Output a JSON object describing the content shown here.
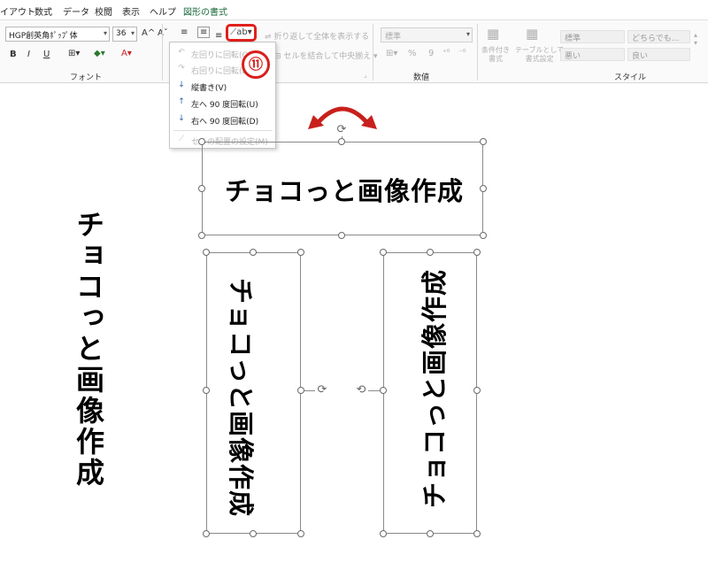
{
  "tabs": [
    {
      "label": "イアウト",
      "active": false
    },
    {
      "label": "数式",
      "active": false
    },
    {
      "label": "データ",
      "active": false
    },
    {
      "label": "校閲",
      "active": false
    },
    {
      "label": "表示",
      "active": false
    },
    {
      "label": "ヘルプ",
      "active": false
    },
    {
      "label": "図形の書式",
      "active": true
    }
  ],
  "ribbon": {
    "font_name": "HGP創英角ﾎﾟｯﾌﾟ体",
    "font_size": "36",
    "grow_font": "A^",
    "shrink_font": "Aˇ",
    "bold": "B",
    "italic": "I",
    "underline": "U",
    "font_group_label": "フォント",
    "wrap_text": "折り返して全体を表示する",
    "merge_center": "セルを結合して中央揃え",
    "number_format": "標準",
    "percent": "%",
    "comma": "9",
    "number_group_label": "数値",
    "conditional_format": "条件付き\n書式",
    "format_as_table": "テーブルとして\n書式設定",
    "styles": [
      "標準",
      "どちらでも...",
      "悪い",
      "良い"
    ],
    "style_group_label": "スタイル"
  },
  "orientation_menu": {
    "items": [
      {
        "label": "左回りに回転(O)",
        "icon": "rotate-ccw-icon",
        "enabled": false
      },
      {
        "label": "右回りに回転(L)",
        "icon": "rotate-cw-icon",
        "enabled": false
      },
      {
        "label": "縦書き(V)",
        "icon": "vertical-text-icon",
        "enabled": true
      },
      {
        "label": "左へ 90 度回転(U)",
        "icon": "rotate-up-icon",
        "enabled": true
      },
      {
        "label": "右へ 90 度回転(D)",
        "icon": "rotate-down-icon",
        "enabled": true
      },
      {
        "label": "セルの配置の設定(M)",
        "icon": "cell-alignment-icon",
        "enabled": false
      }
    ]
  },
  "step_badge": "⑪",
  "shapes": {
    "horizontal_text": "チョコっと画像作成",
    "vertical_text": "チョコっと画像作成",
    "rotated_cw_text": "チョコっと画像作成",
    "rotated_ccw_text": "チョコっと画像作成"
  },
  "colors": {
    "accent_red": "#d8201c",
    "active_tab_green": "#1d6b3d"
  }
}
